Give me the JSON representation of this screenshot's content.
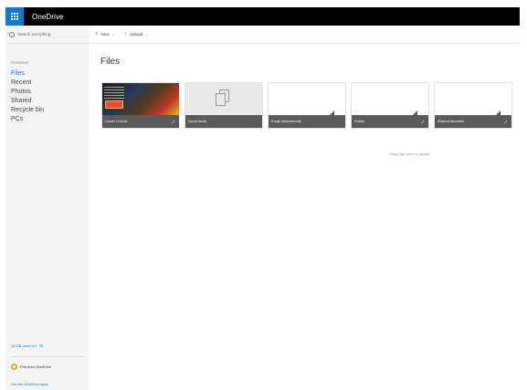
{
  "app": {
    "title": "OneDrive"
  },
  "search": {
    "placeholder": "Search everything"
  },
  "sidebar": {
    "header": "OneDrive",
    "items": [
      {
        "label": "Files",
        "active": true
      },
      {
        "label": "Recent",
        "active": false
      },
      {
        "label": "Photos",
        "active": false
      },
      {
        "label": "Shared",
        "active": false
      },
      {
        "label": "Recycle bin",
        "active": false
      },
      {
        "label": "PCs",
        "active": false
      }
    ],
    "storage": "15 GB used of 1 TB",
    "premium": "Premium OneDrive",
    "get_apps": "Get the OneDrive apps"
  },
  "commands": {
    "new_label": "New",
    "upload_label": "Upload"
  },
  "main": {
    "title": "Files",
    "drop_hint": "Drag files here to upload",
    "tiles": [
      {
        "name": "Crash Course",
        "thumb": "game"
      },
      {
        "name": "Documents",
        "thumb": "docs"
      },
      {
        "name": "Email attachments",
        "thumb": "empty"
      },
      {
        "name": "Public",
        "thumb": "empty"
      },
      {
        "name": "Shared favorites",
        "thumb": "empty"
      }
    ]
  },
  "colors": {
    "accent": "#0f78d4",
    "topbar": "#000000",
    "sidebar": "#f4f4f4",
    "tile_footer": "#5a5a5a"
  }
}
